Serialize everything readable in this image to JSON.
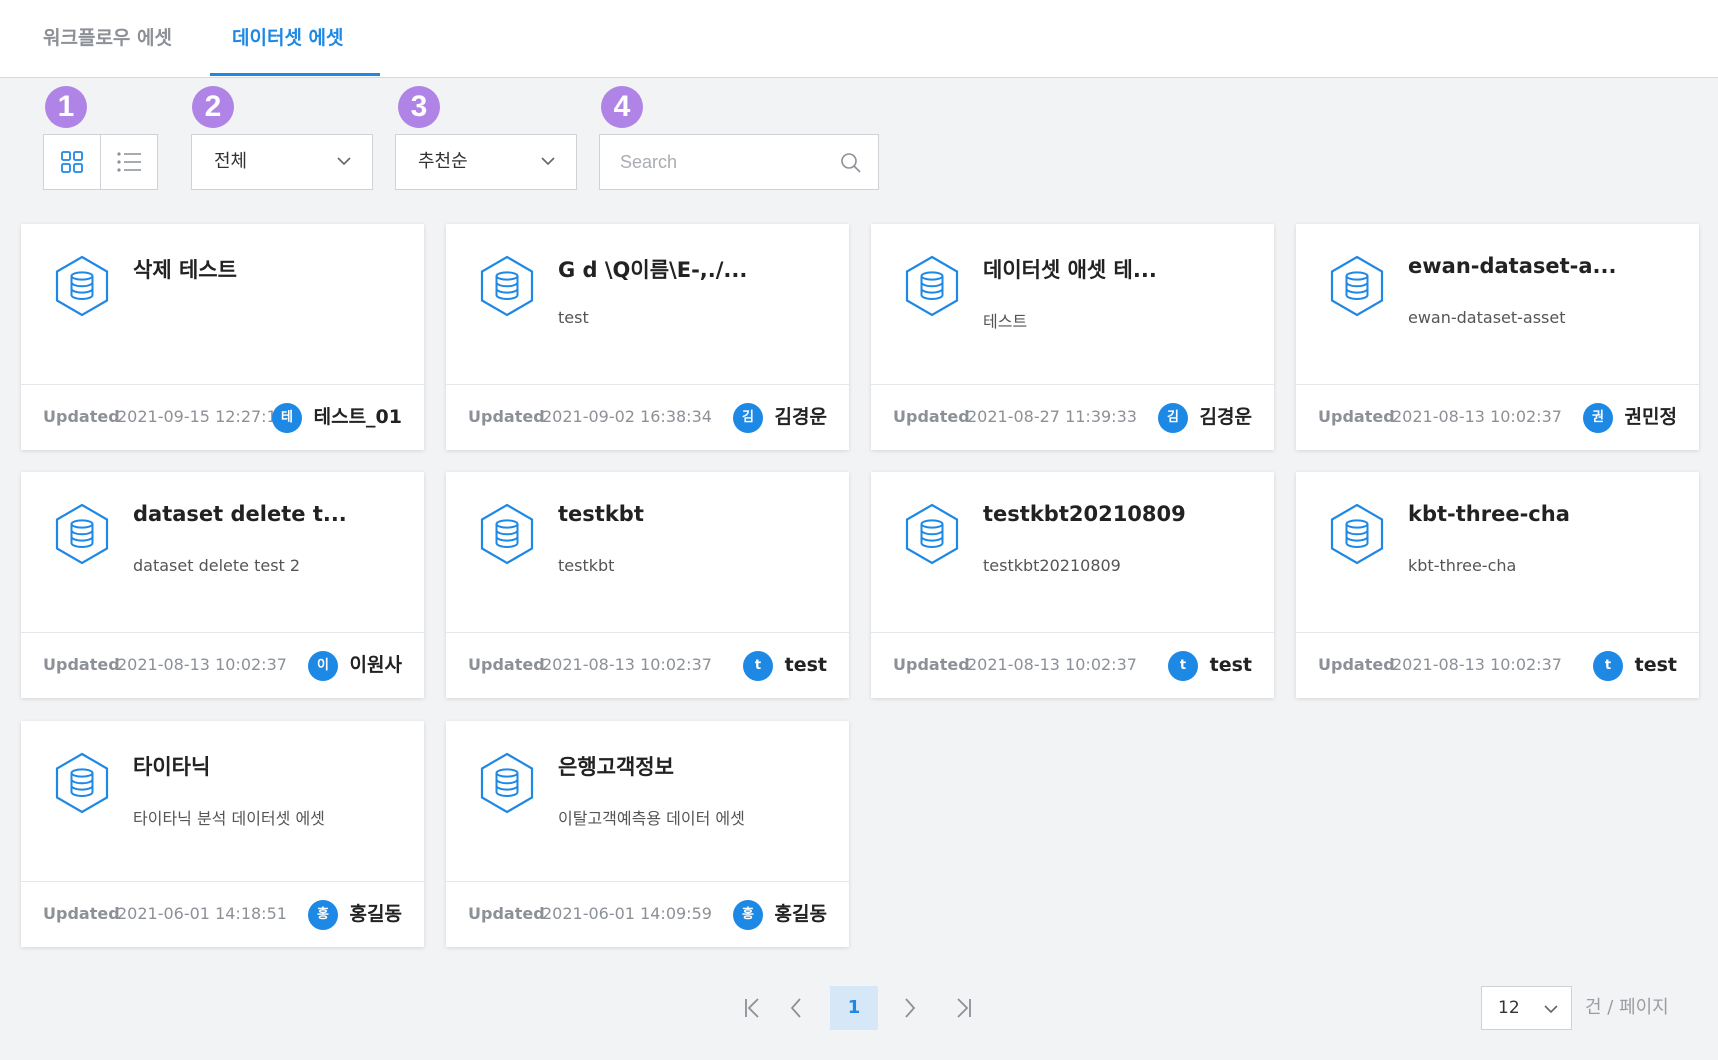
{
  "tabs": [
    {
      "label": "워크플로우 에셋",
      "active": false
    },
    {
      "label": "데이터셋 에셋",
      "active": true
    }
  ],
  "annotations": [
    "1",
    "2",
    "3",
    "4"
  ],
  "toolbar": {
    "view_modes": [
      "grid-icon",
      "list-icon"
    ],
    "filter": {
      "selected": "전체"
    },
    "sort": {
      "selected": "추천순"
    },
    "search": {
      "placeholder": "Search"
    }
  },
  "cards": [
    {
      "title": "삭제 테스트",
      "description": "",
      "updated_label": "Updated",
      "updated": "2021-09-15 12:27:16",
      "avatar": "테",
      "owner": "테스트_01"
    },
    {
      "title": "G d \\Q이름\\E-,./...",
      "description": "test",
      "updated_label": "Updated",
      "updated": "2021-09-02 16:38:34",
      "avatar": "김",
      "owner": "김경운"
    },
    {
      "title": "데이터셋 애셋 테...",
      "description": "테스트",
      "updated_label": "Updated",
      "updated": "2021-08-27 11:39:33",
      "avatar": "김",
      "owner": "김경운"
    },
    {
      "title": "ewan-dataset-a...",
      "description": "ewan-dataset-asset",
      "updated_label": "Updated",
      "updated": "2021-08-13 10:02:37",
      "avatar": "권",
      "owner": "권민정"
    },
    {
      "title": "dataset delete t...",
      "description": "dataset delete test 2",
      "updated_label": "Updated",
      "updated": "2021-08-13 10:02:37",
      "avatar": "이",
      "owner": "이원사"
    },
    {
      "title": "testkbt",
      "description": "testkbt",
      "updated_label": "Updated",
      "updated": "2021-08-13 10:02:37",
      "avatar": "t",
      "owner": "test"
    },
    {
      "title": "testkbt20210809",
      "description": "testkbt20210809",
      "updated_label": "Updated",
      "updated": "2021-08-13 10:02:37",
      "avatar": "t",
      "owner": "test"
    },
    {
      "title": "kbt-three-cha",
      "description": "kbt-three-cha",
      "updated_label": "Updated",
      "updated": "2021-08-13 10:02:37",
      "avatar": "t",
      "owner": "test"
    },
    {
      "title": "타이타닉",
      "description": "타이타닉 분석 데이터셋 에셋",
      "updated_label": "Updated",
      "updated": "2021-06-01 14:18:51",
      "avatar": "홍",
      "owner": "홍길동"
    },
    {
      "title": "은행고객정보",
      "description": "이탈고객예측용 데이터 에셋",
      "updated_label": "Updated",
      "updated": "2021-06-01 14:09:59",
      "avatar": "홍",
      "owner": "홍길동"
    }
  ],
  "pagination": {
    "current_page": "1",
    "page_size": "12",
    "page_size_suffix": "건 / 페이지"
  },
  "colors": {
    "accent": "#1e88e5",
    "badge": "#b083e6",
    "background": "#f2f3f5"
  }
}
